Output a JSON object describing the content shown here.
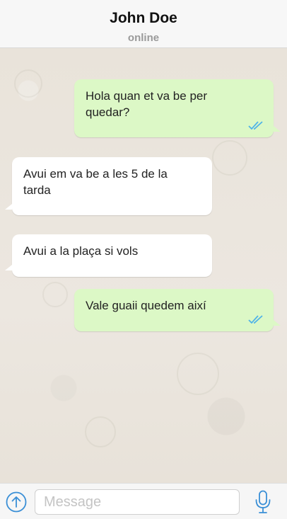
{
  "header": {
    "contact_name": "John Doe",
    "status": "online"
  },
  "messages": [
    {
      "direction": "outgoing",
      "lines": [
        "Hola quan et va be per",
        "quedar?"
      ],
      "read": true
    },
    {
      "direction": "incoming",
      "lines": [
        "Avui em va be a les 5 de la",
        "tarda"
      ]
    },
    {
      "direction": "incoming",
      "lines": [
        "Avui a la plaça si vols"
      ]
    },
    {
      "direction": "outgoing",
      "lines": [
        "Vale guaii quedem així"
      ],
      "read": true
    }
  ],
  "composer": {
    "placeholder": "Message",
    "value": ""
  },
  "icons": {
    "attach": "arrow-up-circle-icon",
    "mic": "microphone-icon",
    "read_receipt": "double-check-icon"
  },
  "colors": {
    "outgoing_bubble": "#dcf8c6",
    "incoming_bubble": "#ffffff",
    "accent_blue": "#3a8fd6",
    "tick_blue": "#4fb3e8"
  }
}
